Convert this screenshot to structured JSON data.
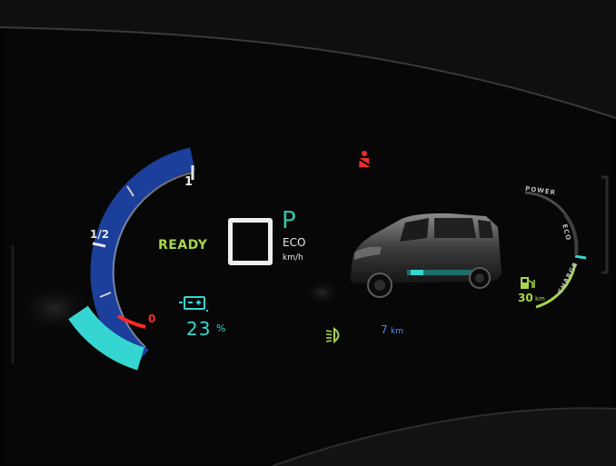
{
  "gauge": {
    "scale_labels": {
      "full": "1",
      "half": "1/2",
      "empty": "0"
    },
    "battery_level": 0.23,
    "battery_percent_value": "23",
    "battery_percent_symbol": "%",
    "battery_icon": "battery-icon"
  },
  "status": {
    "ready": "READY"
  },
  "center": {
    "gear": "P",
    "drive_mode": "ECO",
    "speed_unit": "km/h"
  },
  "indicators": {
    "seatbelt_icon": "seatbelt-warning-icon",
    "seatbelt_color": "#e8302a",
    "headlight_icon": "low-beam-headlight-icon",
    "headlight_color": "#a8d64a"
  },
  "trip": {
    "range_value": "7",
    "range_unit": "km"
  },
  "power_meter": {
    "labels": {
      "power": "POWER",
      "eco": "ECO",
      "charge": "CHARGE"
    },
    "range_value": "30",
    "range_unit": "km",
    "range_icon": "fuel-pump-icon"
  },
  "colors": {
    "teal": "#35d6d2",
    "green": "#a8d64a",
    "blue": "#4a8ee8",
    "red": "#ff2a2a"
  }
}
